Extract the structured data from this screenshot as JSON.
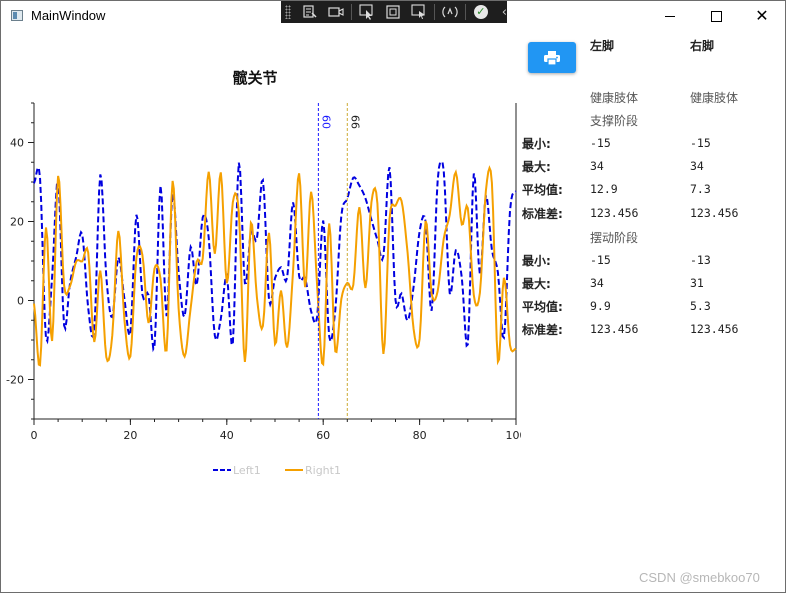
{
  "window": {
    "title": "MainWindow"
  },
  "chart": {
    "title": "髋关节",
    "xlim": [
      0,
      100
    ],
    "ylim": [
      -30,
      50
    ],
    "xticks": [
      0,
      20,
      40,
      60,
      80,
      100
    ],
    "yticks": [
      -20,
      0,
      20,
      40
    ],
    "markers": [
      {
        "label": "60",
        "x": 59,
        "color": "#1a1aff"
      },
      {
        "label": "66",
        "x": 65,
        "color": "#ccaa33"
      }
    ],
    "series": [
      {
        "name": "Left1",
        "color": "#0000e0",
        "dash": "6,3"
      },
      {
        "name": "Right1",
        "color": "#f5a000",
        "dash": ""
      }
    ]
  },
  "stats": {
    "col_left": "左脚",
    "col_right": "右脚",
    "status_left": "健康肢体",
    "status_right": "健康肢体",
    "stance_title": "支撑阶段",
    "swing_title": "摆动阶段",
    "labels": {
      "min": "最小:",
      "max": "最大:",
      "avg": "平均值:",
      "std": "标准差:"
    },
    "stance": {
      "left": {
        "min": "-15",
        "max": "34",
        "avg": "12.9",
        "std": "123.456"
      },
      "right": {
        "min": "-15",
        "max": "34",
        "avg": "7.3",
        "std": "123.456"
      }
    },
    "swing": {
      "left": {
        "min": "-15",
        "max": "34",
        "avg": "9.9",
        "std": "123.456"
      },
      "right": {
        "min": "-13",
        "max": "31",
        "avg": "5.3",
        "std": "123.456"
      }
    }
  },
  "watermark": "CSDN @smebkoo70",
  "icons": {
    "print": "printer-icon",
    "window_min": "minimize-icon",
    "window_max": "maximize-icon",
    "window_close": "close-icon"
  }
}
